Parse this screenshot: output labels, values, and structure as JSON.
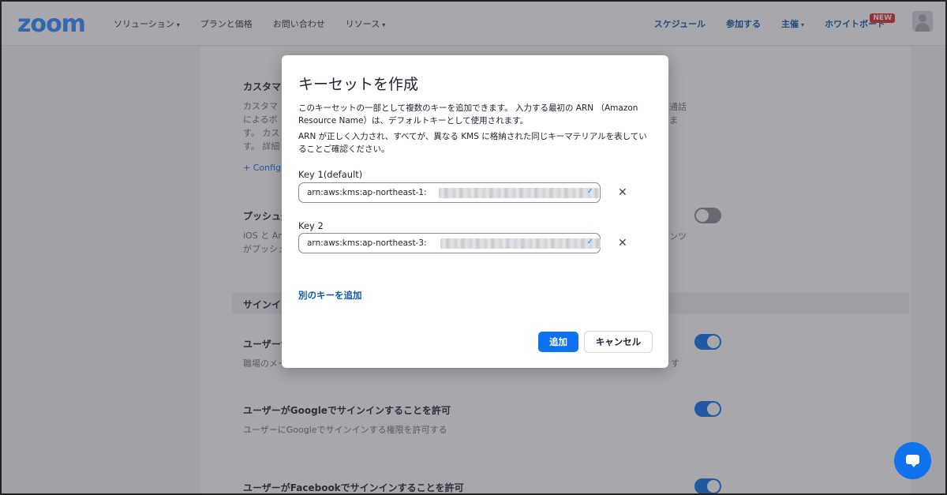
{
  "header": {
    "logo": "zoom",
    "nav_left": [
      {
        "label": "ソリューション",
        "caret": "▾"
      },
      {
        "label": "プランと価格",
        "caret": ""
      },
      {
        "label": "お問い合わせ",
        "caret": ""
      },
      {
        "label": "リソース",
        "caret": "▾"
      }
    ],
    "nav_right": [
      {
        "label": "スケジュール",
        "caret": ""
      },
      {
        "label": "参加する",
        "caret": ""
      },
      {
        "label": "主催",
        "caret": "▾"
      },
      {
        "label": "ホワイトボード",
        "caret": ""
      }
    ],
    "new_badge": "NEW",
    "avatar_icon": "user-avatar-icon"
  },
  "background": {
    "custom_section": {
      "title": "カスタマー",
      "desc_lines": [
        "カスタマ",
        "によるボ",
        "す。 カス",
        "す。 詳細"
      ],
      "desc_right_lines": [
        "通話",
        "",
        "ま"
      ],
      "configure_link": "+ Configu"
    },
    "push_section": {
      "title": "プッシュ通",
      "desc_lines": [
        "iOS と An",
        "がプッシュ"
      ],
      "desc_right": "ンツ"
    },
    "signin_band": "サインイン",
    "user_section": {
      "title": "ユーザーが",
      "desc": "職場のメー",
      "desc_right": "す"
    },
    "google_section": {
      "title": "ユーザーがGoogleでサインインすることを許可",
      "desc": "ユーザーにGoogleでサインインする権限を許可する"
    },
    "facebook_section": {
      "title": "ユーザーがFacebookでサインインすることを許可"
    }
  },
  "modal": {
    "title": "キーセットを作成",
    "desc_1": "このキーセットの一部として複数のキーを追加できます。 入力する最初の ARN （Amazon Resource Name）は、デフォルトキーとして使用されます。",
    "desc_2": "ARN が正しく入力され、すべてが、異なる KMS に格納された同じキーマテリアルを表していることご確認ください。",
    "keys": [
      {
        "label": "Key 1(default)",
        "value": "arn:aws:kms:ap-northeast-1:",
        "check": "✓",
        "remove": "✕"
      },
      {
        "label": "Key 2",
        "value": "arn:aws:kms:ap-northeast-3:",
        "check": "✓",
        "remove": "✕"
      }
    ],
    "add_another": "別のキーを追加",
    "add_button": "追加",
    "cancel_button": "キャンセル"
  },
  "colors": {
    "brand": "#2d8cff",
    "primary_button": "#0e72ed",
    "link": "#0e5aa7"
  }
}
